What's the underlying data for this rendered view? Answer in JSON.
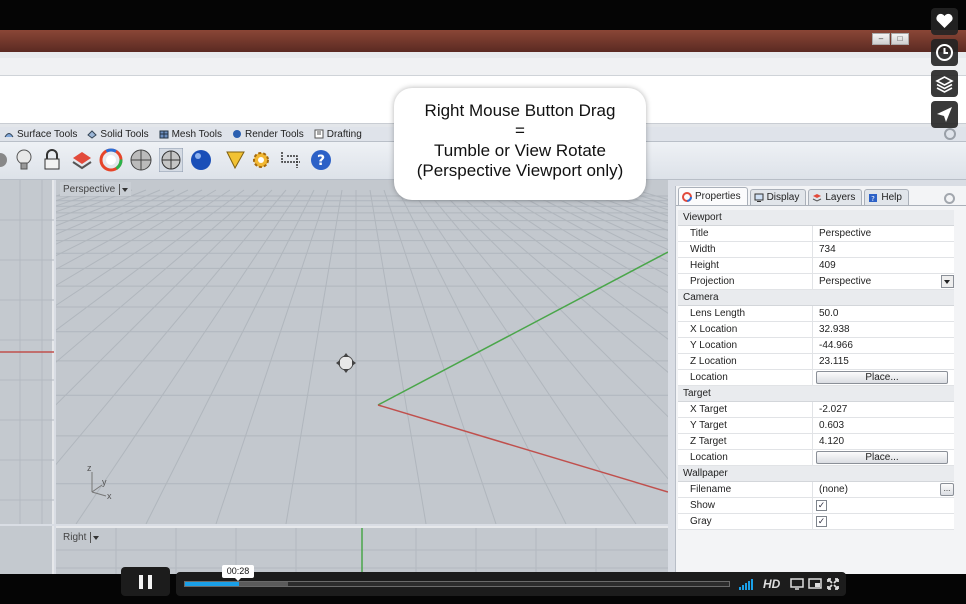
{
  "toolbar_tabs": [
    {
      "label": "Surface Tools"
    },
    {
      "label": "Solid Tools"
    },
    {
      "label": "Mesh Tools"
    },
    {
      "label": "Render Tools"
    },
    {
      "label": "Drafting"
    }
  ],
  "viewports": {
    "main_title": "Perspective",
    "lower_title": "Right",
    "axis_labels": {
      "z": "z",
      "y": "y",
      "x": "x"
    }
  },
  "annotation": {
    "line1": "Right Mouse Button Drag",
    "line2": "=",
    "line3": "Tumble or View Rotate",
    "line4": "(Perspective Viewport only)"
  },
  "panel": {
    "tabs": [
      {
        "label": "Properties"
      },
      {
        "label": "Display"
      },
      {
        "label": "Layers"
      },
      {
        "label": "Help"
      }
    ],
    "sections": {
      "viewport": "Viewport",
      "camera": "Camera",
      "target": "Target",
      "wallpaper": "Wallpaper"
    },
    "viewport": {
      "title": {
        "name": "Title",
        "value": "Perspective"
      },
      "width": {
        "name": "Width",
        "value": "734"
      },
      "height": {
        "name": "Height",
        "value": "409"
      },
      "projection": {
        "name": "Projection",
        "value": "Perspective"
      }
    },
    "camera": {
      "lens_length": {
        "name": "Lens Length",
        "value": "50.0"
      },
      "x_location": {
        "name": "X Location",
        "value": "32.938"
      },
      "y_location": {
        "name": "Y Location",
        "value": "-44.966"
      },
      "z_location": {
        "name": "Z Location",
        "value": "23.115"
      },
      "location": {
        "name": "Location",
        "button": "Place..."
      }
    },
    "target": {
      "x_target": {
        "name": "X Target",
        "value": "-2.027"
      },
      "y_target": {
        "name": "Y Target",
        "value": "0.603"
      },
      "z_target": {
        "name": "Z Target",
        "value": "4.120"
      },
      "location": {
        "name": "Location",
        "button": "Place..."
      }
    },
    "wallpaper": {
      "filename": {
        "name": "Filename",
        "value": "(none)",
        "button": "..."
      },
      "show": {
        "name": "Show",
        "checked": true
      },
      "gray": {
        "name": "Gray",
        "checked": true
      }
    }
  },
  "window_buttons": {
    "minimize": "–",
    "maximize": "□"
  },
  "player": {
    "time": "00:28",
    "progress_fraction": 0.1,
    "loaded_fraction": 0.19,
    "hd_label": "HD",
    "side_buttons": [
      "heart-icon",
      "clock-icon",
      "layers-icon",
      "send-icon"
    ]
  },
  "colors": {
    "accent": "#1aa0e8",
    "viewport_bg": "#c3c8ce",
    "x_axis": "#c0504d",
    "y_axis": "#4aa64a"
  }
}
